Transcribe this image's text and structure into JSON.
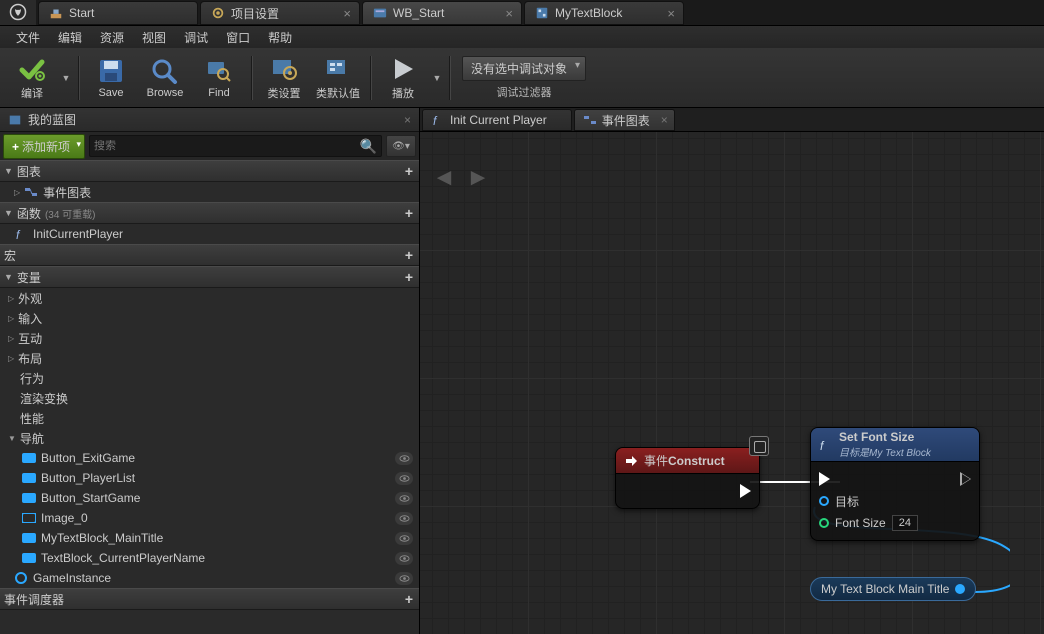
{
  "tabs": {
    "t0": "Start",
    "t1": "项目设置",
    "t2": "WB_Start",
    "t3": "MyTextBlock"
  },
  "menu": {
    "file": "文件",
    "edit": "编辑",
    "asset": "资源",
    "view": "视图",
    "debug": "调试",
    "window": "窗口",
    "help": "帮助"
  },
  "toolbar": {
    "compile": "编译",
    "save": "Save",
    "browse": "Browse",
    "find": "Find",
    "classset": "类设置",
    "classdef": "类默认值",
    "play": "播放",
    "debugsel": "没有选中调试对象",
    "debugfilt": "调试过滤器"
  },
  "panel": {
    "title": "我的蓝图",
    "addnew": "添加新项",
    "searchPlaceholder": "搜索"
  },
  "sections": {
    "graphs": "图表",
    "eventgraph": "事件图表",
    "functions": "函数",
    "functions_sub": "(34 可重载)",
    "fn_init": "InitCurrentPlayer",
    "macros": "宏",
    "variables": "变量",
    "var_appearance": "外观",
    "var_input": "输入",
    "var_interact": "互动",
    "var_layout": "布局",
    "var_behavior": "行为",
    "var_render": "渲染变换",
    "var_perf": "性能",
    "var_nav": "导航",
    "v_exit": "Button_ExitGame",
    "v_plist": "Button_PlayerList",
    "v_start": "Button_StartGame",
    "v_img": "Image_0",
    "v_title": "MyTextBlock_MainTitle",
    "v_curp": "TextBlock_CurrentPlayerName",
    "v_gi": "GameInstance",
    "dispatchers": "事件调度器"
  },
  "graphtabs": {
    "init": "Init Current Player",
    "eg": "事件图表"
  },
  "nodes": {
    "construct": "事件",
    "construct2": "Construct",
    "setfont": "Set Font Size",
    "setfont_sub": "目标是My Text Block",
    "target": "目标",
    "fontsize": "Font Size",
    "fontsize_val": "24",
    "varref": "My Text Block Main Title"
  }
}
